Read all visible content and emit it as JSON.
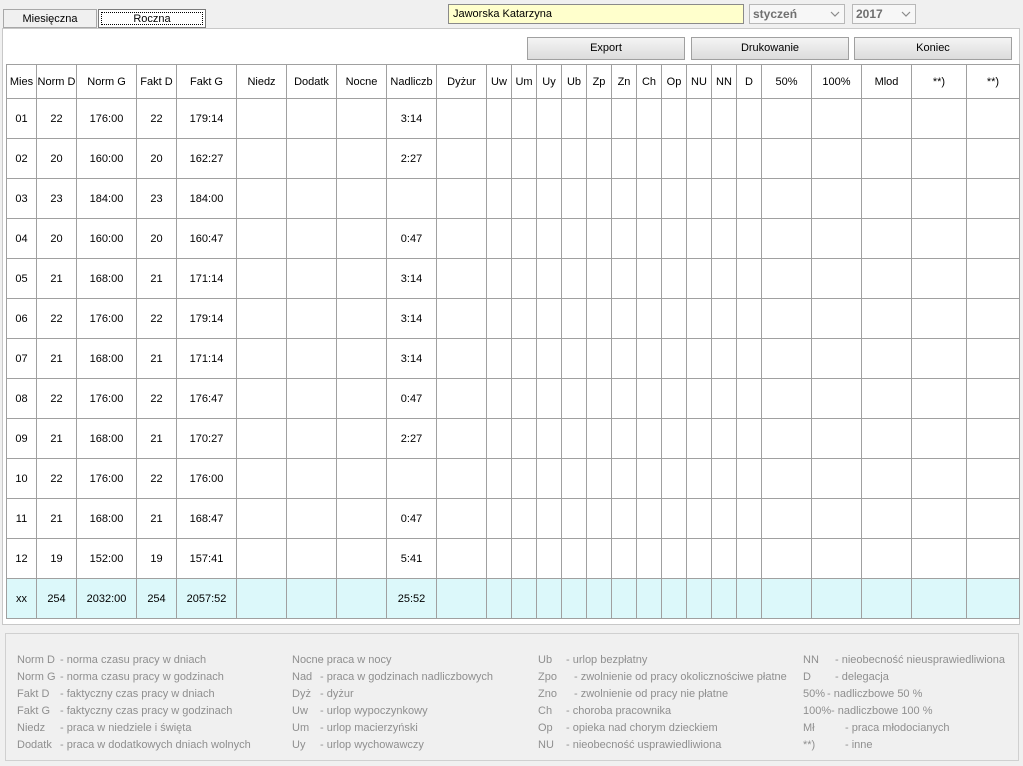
{
  "tabs": [
    {
      "label": "Miesięczna",
      "active": false
    },
    {
      "label": "Roczna",
      "active": true
    }
  ],
  "employee_name": "Jaworska Katarzyna",
  "month_select": "styczeń",
  "year_select": "2017",
  "buttons": {
    "export": "Export",
    "print": "Drukowanie",
    "close": "Koniec"
  },
  "table": {
    "columns": [
      "Mies",
      "Norm D",
      "Norm G",
      "Fakt D",
      "Fakt G",
      "Niedz",
      "Dodatk",
      "Nocne",
      "Nadliczb",
      "Dyżur",
      "Uw",
      "Um",
      "Uy",
      "Ub",
      "Zp",
      "Zn",
      "Ch",
      "Op",
      "NU",
      "NN",
      "D",
      "50%",
      "100%",
      "Mlod",
      "**)",
      "**)"
    ],
    "rows": [
      [
        "01",
        "22",
        "176:00",
        "22",
        "179:14",
        "",
        "",
        "",
        "3:14"
      ],
      [
        "02",
        "20",
        "160:00",
        "20",
        "162:27",
        "",
        "",
        "",
        "2:27"
      ],
      [
        "03",
        "23",
        "184:00",
        "23",
        "184:00",
        "",
        "",
        "",
        ""
      ],
      [
        "04",
        "20",
        "160:00",
        "20",
        "160:47",
        "",
        "",
        "",
        "0:47"
      ],
      [
        "05",
        "21",
        "168:00",
        "21",
        "171:14",
        "",
        "",
        "",
        "3:14"
      ],
      [
        "06",
        "22",
        "176:00",
        "22",
        "179:14",
        "",
        "",
        "",
        "3:14"
      ],
      [
        "07",
        "21",
        "168:00",
        "21",
        "171:14",
        "",
        "",
        "",
        "3:14"
      ],
      [
        "08",
        "22",
        "176:00",
        "22",
        "176:47",
        "",
        "",
        "",
        "0:47"
      ],
      [
        "09",
        "21",
        "168:00",
        "21",
        "170:27",
        "",
        "",
        "",
        "2:27"
      ],
      [
        "10",
        "22",
        "176:00",
        "22",
        "176:00",
        "",
        "",
        "",
        ""
      ],
      [
        "11",
        "21",
        "168:00",
        "21",
        "168:47",
        "",
        "",
        "",
        "0:47"
      ],
      [
        "12",
        "19",
        "152:00",
        "19",
        "157:41",
        "",
        "",
        "",
        "5:41"
      ]
    ],
    "total": [
      "xx",
      "254",
      "2032:00",
      "254",
      "2057:52",
      "",
      "",
      "",
      "25:52"
    ]
  },
  "legend": [
    [
      {
        "abbr": "Norm D",
        "desc": "- norma czasu pracy w dniach"
      },
      {
        "abbr": "Norm G",
        "desc": "- norma czasu pracy w godzinach"
      },
      {
        "abbr": "Fakt D",
        "desc": "- faktyczny czas pracy w dniach"
      },
      {
        "abbr": "Fakt G",
        "desc": "- faktyczny czas pracy w godzinach"
      },
      {
        "abbr": "Niedz",
        "desc": "- praca w niedziele i święta"
      },
      {
        "abbr": "Dodatk",
        "desc": "- praca w dodatkowych dniach wolnych"
      }
    ],
    [
      {
        "abbr": "Nocne",
        "desc": "- praca w nocy"
      },
      {
        "abbr": "Nad",
        "desc": "- praca w godzinach nadliczbowych"
      },
      {
        "abbr": "Dyż",
        "desc": "- dyżur"
      },
      {
        "abbr": "Uw",
        "desc": "- urlop wypoczynkowy"
      },
      {
        "abbr": "Um",
        "desc": "- urlop macierzyński"
      },
      {
        "abbr": "Uy",
        "desc": "- urlop wychowawczy"
      }
    ],
    [
      {
        "abbr": "Ub",
        "desc": "- urlop bezpłatny"
      },
      {
        "abbr": "Zpo",
        "desc": "- zwolnienie od pracy okolicznościwe płatne"
      },
      {
        "abbr": "Zno",
        "desc": "- zwolnienie od pracy nie płatne"
      },
      {
        "abbr": "Ch",
        "desc": "- choroba pracownika"
      },
      {
        "abbr": "Op",
        "desc": "- opieka nad chorym dzieckiem"
      },
      {
        "abbr": "NU",
        "desc": "- nieobecność usprawiedliwiona"
      }
    ],
    [
      {
        "abbr": "NN",
        "desc": "- nieobecność nieusprawiedliwiona"
      },
      {
        "abbr": "D",
        "desc": "- delegacja"
      },
      {
        "abbr": "50%",
        "desc": "- nadliczbowe 50 %"
      },
      {
        "abbr": "100%",
        "desc": "- nadliczbowe 100 %"
      },
      {
        "abbr": "Mł",
        "desc": "- praca młodocianych"
      },
      {
        "abbr": "**)",
        "desc": "- inne"
      }
    ]
  ],
  "icons": {
    "dropdown": "chevron-down-icon"
  }
}
